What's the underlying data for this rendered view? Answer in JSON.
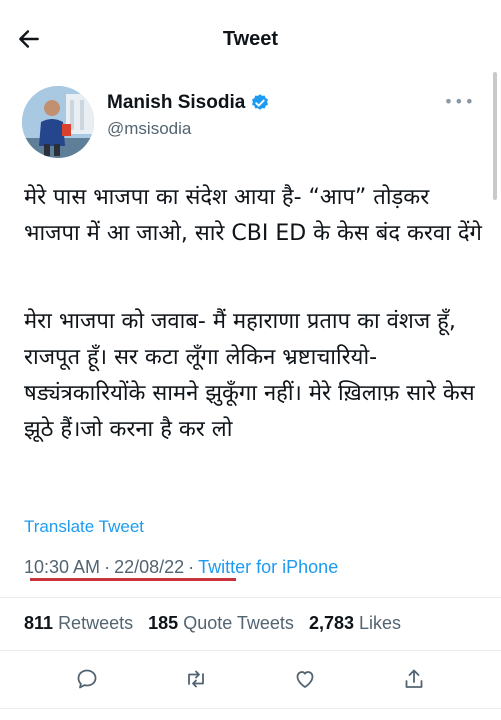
{
  "header": {
    "title": "Tweet",
    "back_icon": "arrow-left-icon"
  },
  "author": {
    "name": "Manish Sisodia",
    "handle": "@msisodia",
    "verified_icon": "verified-badge-icon",
    "verified_color": "#1d9bf0"
  },
  "tweet": {
    "paragraph1": "मेरे पास भाजपा का संदेश आया है- “आप” तोड़कर भाजपा में आ जाओ, सारे CBI ED के केस बंद करवा देंगे",
    "paragraph2": "मेरा भाजपा को जवाब- मैं महाराणा प्रताप का वंशज हूँ, राजपूत हूँ। सर कटा लूँगा लेकिन भ्रष्टाचारियो-षड्यंत्रकारियोंके सामने झुकूँगा नहीं। मेरे ख़िलाफ़ सारे केस झूठे हैं।जो करना है कर लो"
  },
  "translate_label": "Translate Tweet",
  "meta": {
    "time": "10:30 AM",
    "date": "22/08/22",
    "source": "Twitter for iPhone",
    "separator": "·"
  },
  "stats": {
    "retweets": "811",
    "retweets_label": "Retweets",
    "quotes": "185",
    "quotes_label": "Quote Tweets",
    "likes": "2,783",
    "likes_label": "Likes"
  },
  "actions": [
    "reply-icon",
    "retweet-icon",
    "like-icon",
    "share-icon"
  ],
  "colors": {
    "link": "#1d9bf0",
    "secondary_text": "#536471",
    "annotation_underline": "#c8343a"
  }
}
